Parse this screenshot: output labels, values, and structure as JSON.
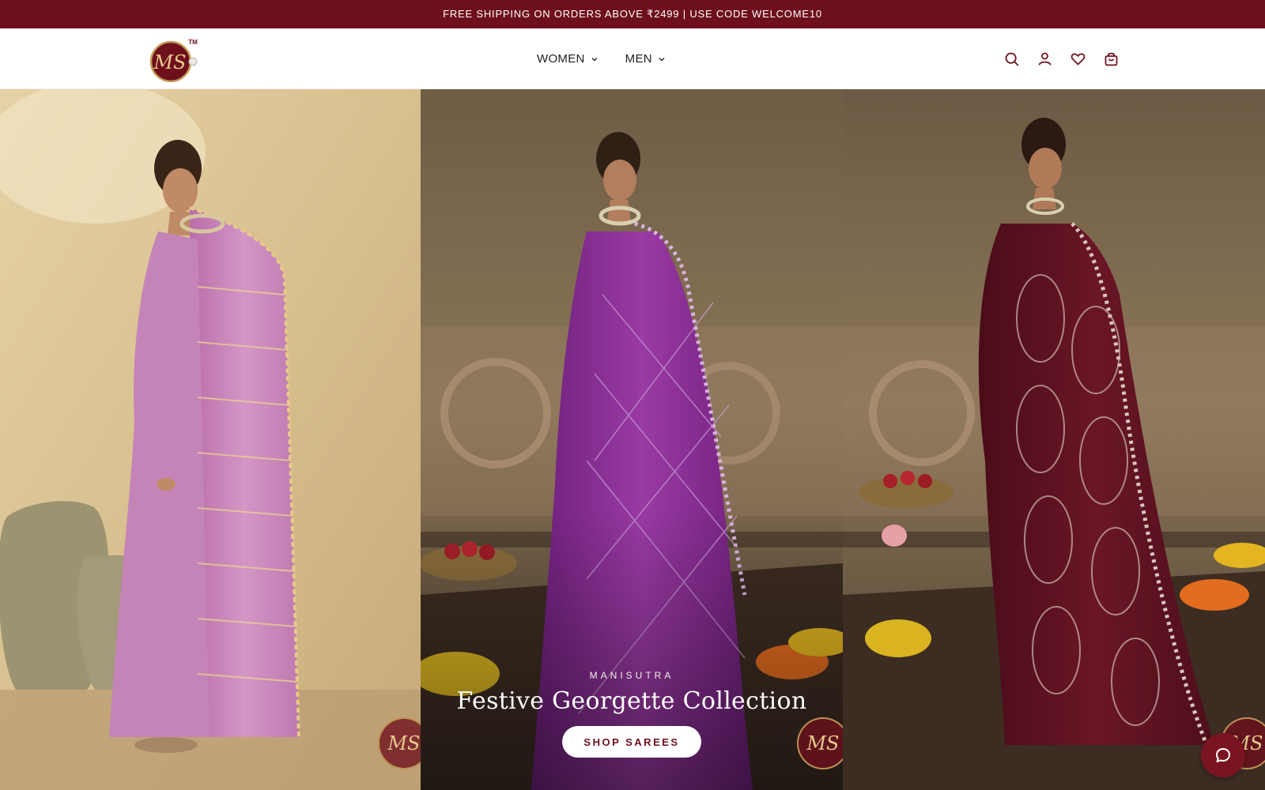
{
  "announcement": {
    "text": "FREE SHIPPING ON ORDERS ABOVE ₹2499 | USE CODE WELCOME10"
  },
  "header": {
    "logo": {
      "monogram": "MS",
      "trademark": "TM"
    },
    "nav": [
      {
        "label": "WOMEN",
        "icon": "chevron-down-icon"
      },
      {
        "label": "MEN",
        "icon": "chevron-down-icon"
      }
    ],
    "icons": [
      "search-icon",
      "account-icon",
      "wishlist-heart-icon",
      "cart-bag-icon"
    ]
  },
  "hero": {
    "kicker": "MANISUTRA",
    "title": "Festive Georgette Collection",
    "cta_label": "SHOP SAREES",
    "panels": [
      {
        "saree_color": "#c97fb8",
        "backdrop": "#d9c294"
      },
      {
        "saree_color": "#8a2b92",
        "backdrop": "#7d6a50"
      },
      {
        "saree_color": "#5a1020",
        "backdrop": "#7f6c52"
      }
    ],
    "watermark": "MS"
  },
  "chat": {
    "icon": "chat-bubble-icon"
  },
  "colors": {
    "brand": "#6e101c",
    "accent_gold": "#c49e5a"
  }
}
